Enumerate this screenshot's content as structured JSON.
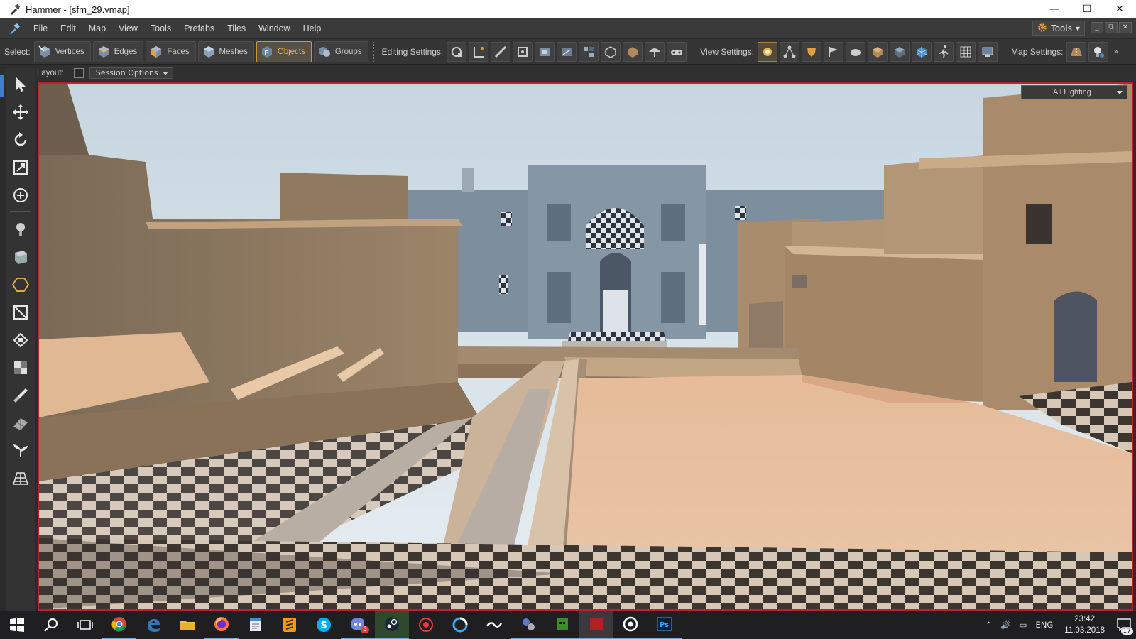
{
  "window": {
    "title": "Hammer - [sfm_29.vmap]",
    "controls": [
      "minimize",
      "maximize",
      "close"
    ]
  },
  "menu": {
    "items": [
      "File",
      "Edit",
      "Map",
      "View",
      "Tools",
      "Prefabs",
      "Tiles",
      "Window",
      "Help"
    ],
    "tools_button": "Tools"
  },
  "toolbar": {
    "select_label": "Select:",
    "select_modes": [
      {
        "label": "Vertices",
        "active": false
      },
      {
        "label": "Edges",
        "active": false
      },
      {
        "label": "Faces",
        "active": false
      },
      {
        "label": "Meshes",
        "active": false
      },
      {
        "label": "Objects",
        "active": true
      },
      {
        "label": "Groups",
        "active": false
      }
    ],
    "editing_label": "Editing Settings:",
    "view_label": "View Settings:",
    "map_label": "Map Settings:"
  },
  "layout_bar": {
    "label": "Layout:",
    "session_options": "Session Options"
  },
  "viewport": {
    "lighting_mode": "All Lighting",
    "accent_color": "#c0202a"
  },
  "taskbar": {
    "language": "ENG",
    "time": "23:42",
    "date": "11.03.2018",
    "notification_count": "17",
    "discord_badge": "5"
  }
}
